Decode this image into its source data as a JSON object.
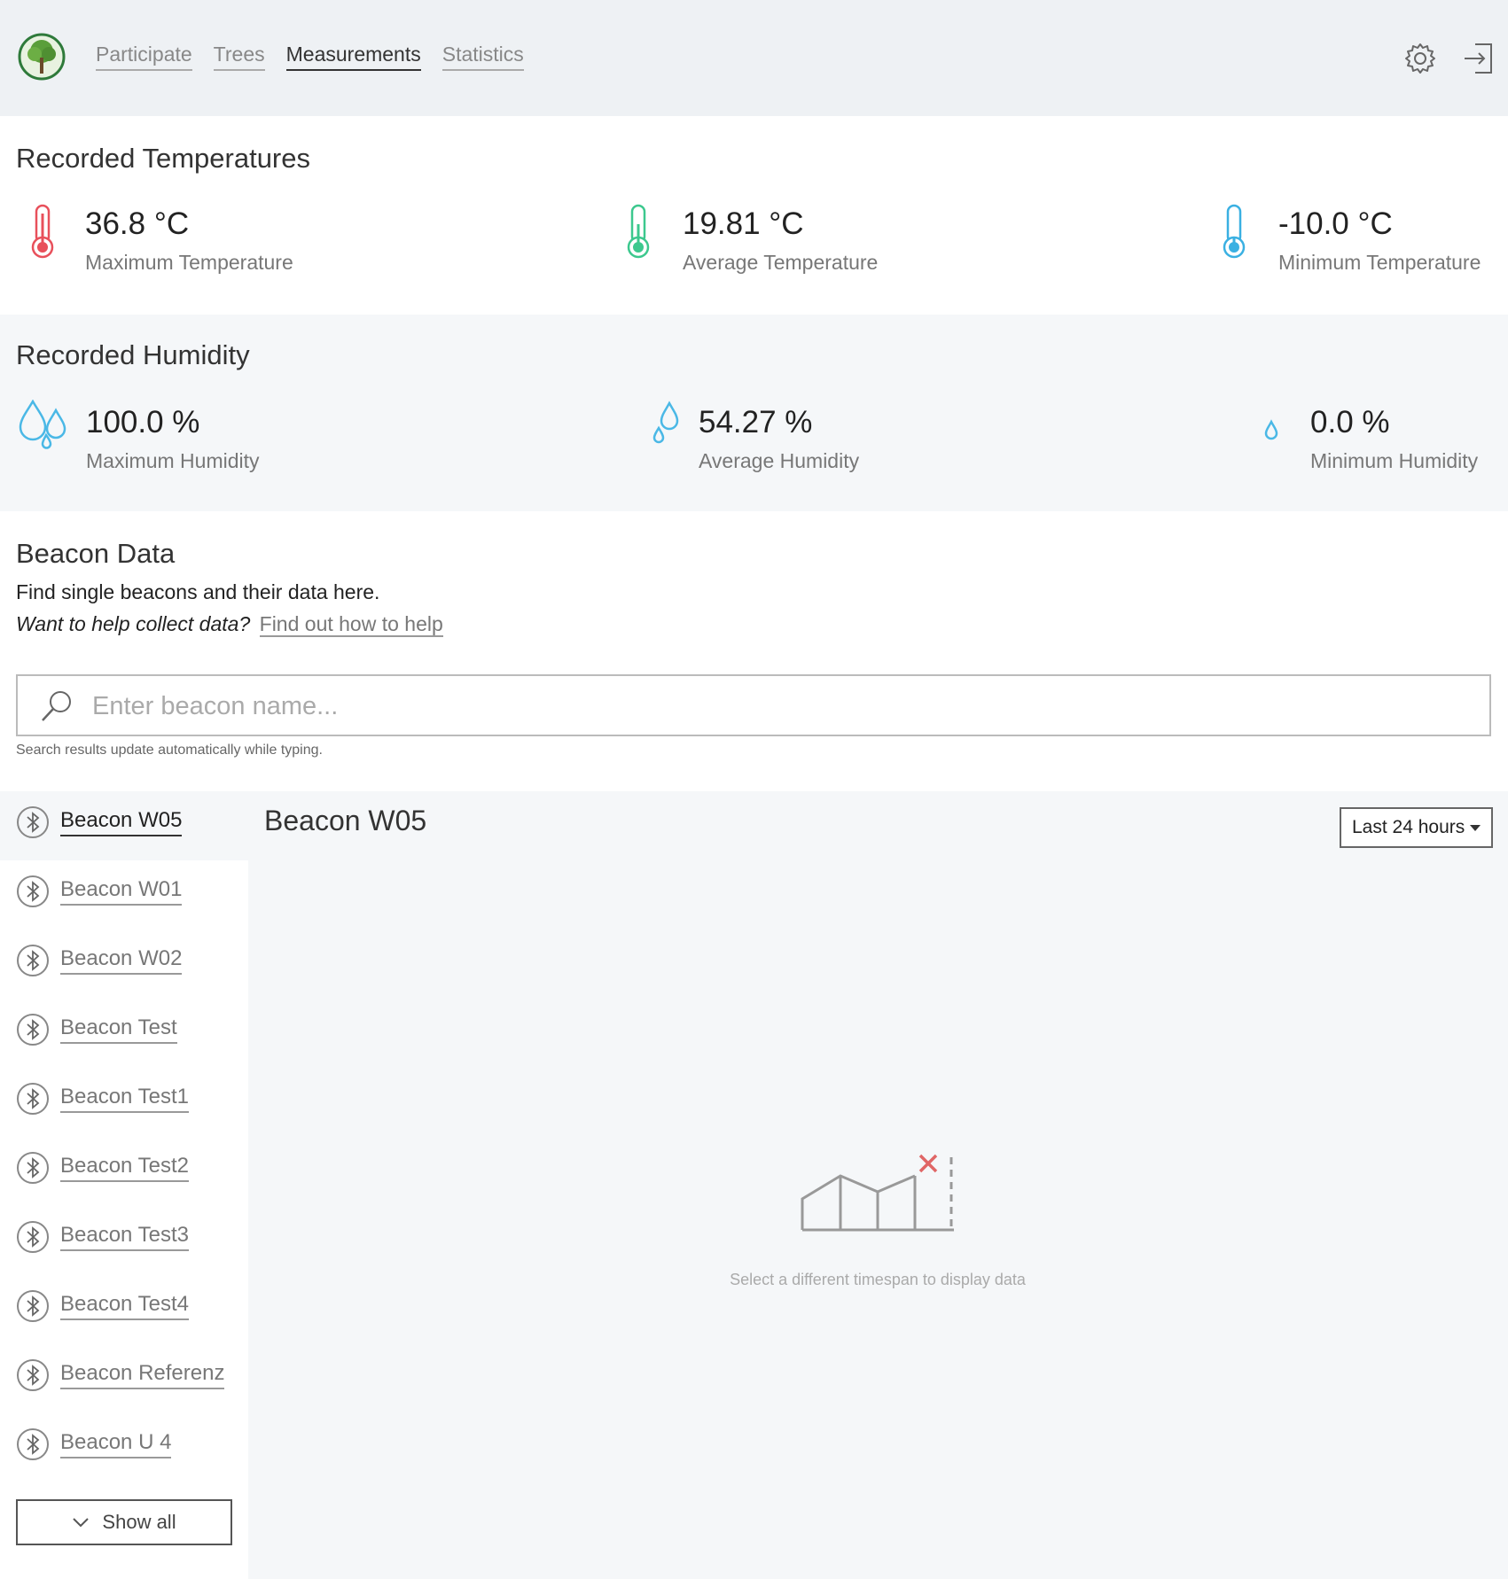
{
  "nav": {
    "items": [
      "Participate",
      "Trees",
      "Measurements",
      "Statistics"
    ],
    "active": "Measurements"
  },
  "temperatures": {
    "title": "Recorded Temperatures",
    "max": {
      "value": "36.8 °C",
      "label": "Maximum Temperature",
      "color": "#e8505b"
    },
    "avg": {
      "value": "19.81 °C",
      "label": "Average Temperature",
      "color": "#3cc88e"
    },
    "min": {
      "value": "-10.0 °C",
      "label": "Minimum Temperature",
      "color": "#3ab0e2"
    }
  },
  "humidity": {
    "title": "Recorded Humidity",
    "max": {
      "value": "100.0 %",
      "label": "Maximum Humidity"
    },
    "avg": {
      "value": "54.27 %",
      "label": "Average Humidity"
    },
    "min": {
      "value": "0.0 %",
      "label": "Minimum Humidity"
    }
  },
  "beacon_data": {
    "title": "Beacon Data",
    "description": "Find single beacons and their data here.",
    "help_question": "Want to help collect data?",
    "help_link": "Find out how to help",
    "search_placeholder": "Enter beacon name...",
    "search_value": "",
    "search_hint": "Search results update automatically while typing."
  },
  "beacons": [
    "Beacon W05",
    "Beacon W01",
    "Beacon W02",
    "Beacon Test",
    "Beacon Test1",
    "Beacon Test2",
    "Beacon Test3",
    "Beacon Test4",
    "Beacon Referenz",
    "Beacon U 4"
  ],
  "selected_beacon": "Beacon W05",
  "show_all_label": "Show all",
  "detail": {
    "title": "Beacon W05",
    "timespan": "Last 24 hours",
    "empty_message": "Select a different timespan to display data"
  },
  "colors": {
    "accent_red": "#e06666",
    "droplet": "#4ab8e6",
    "icon_gray": "#777777"
  }
}
